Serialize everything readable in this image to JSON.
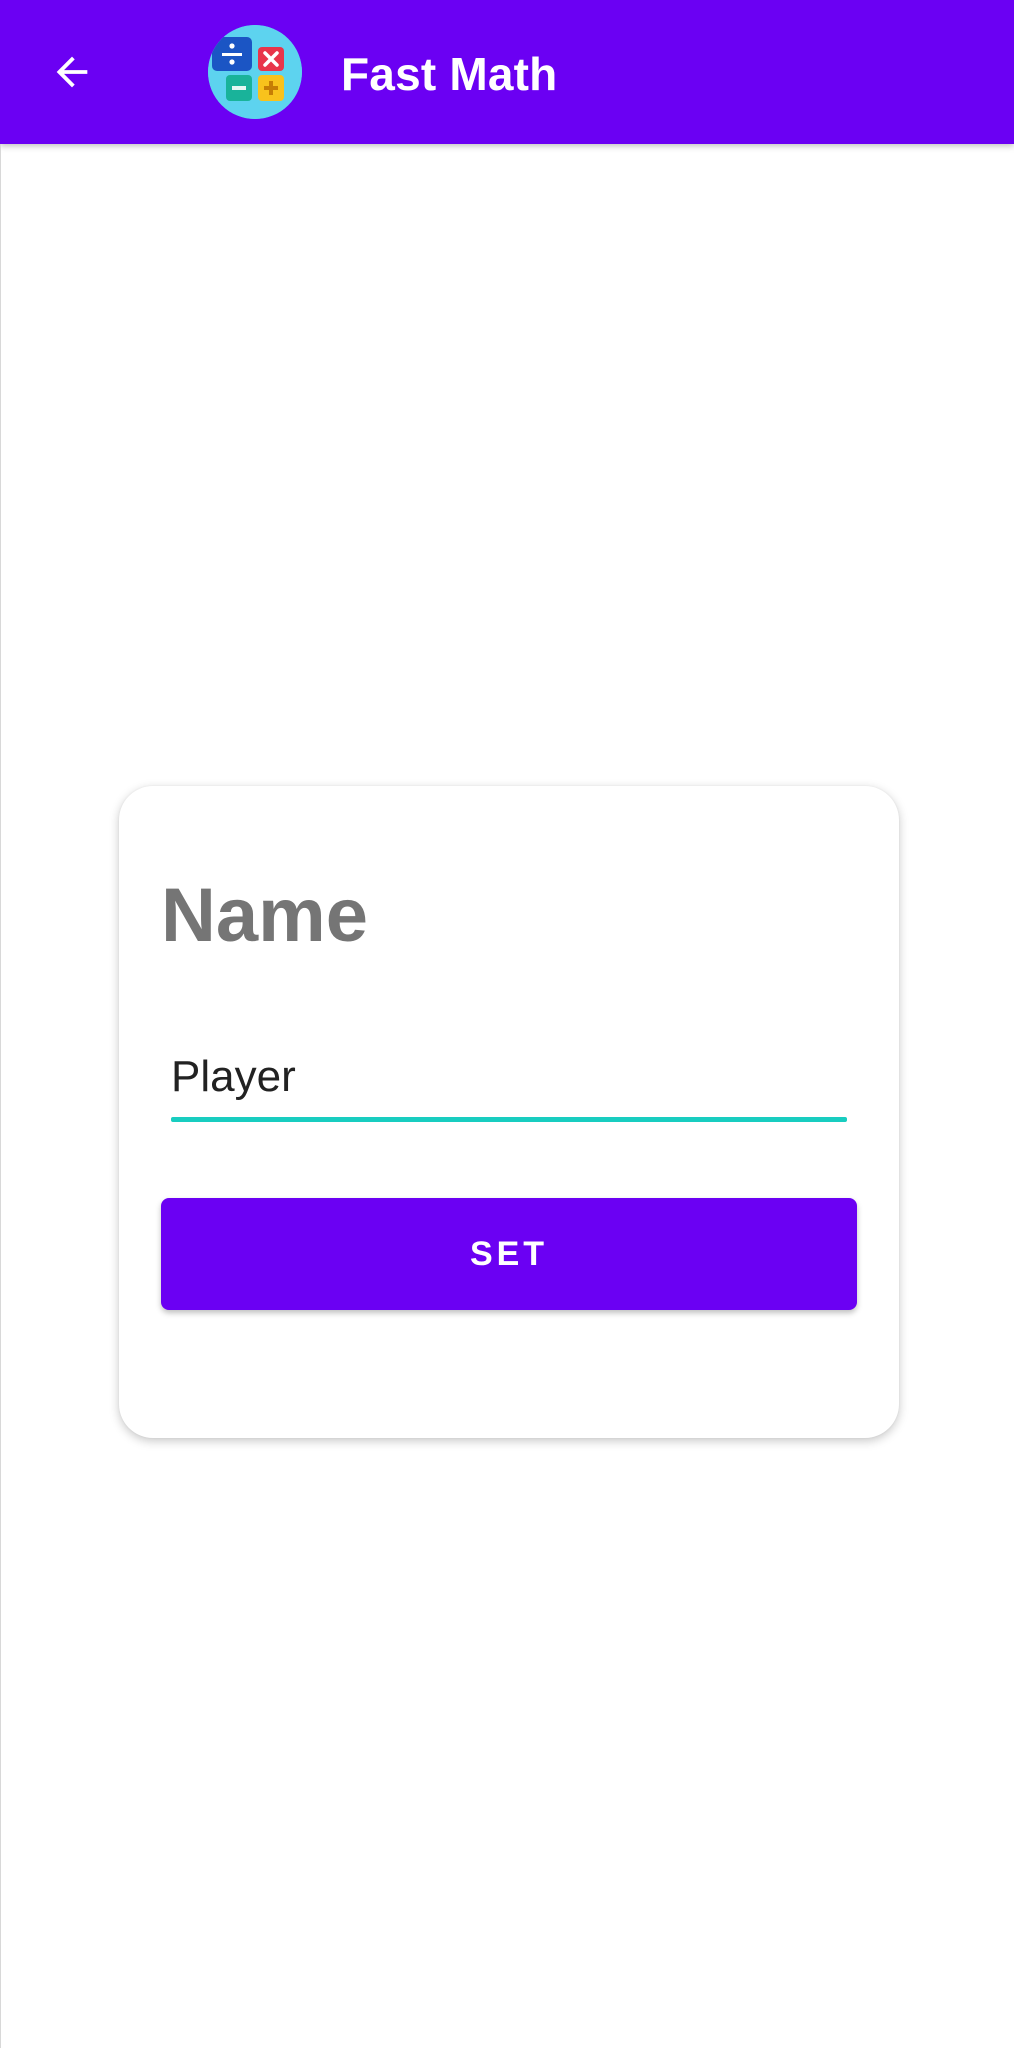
{
  "appbar": {
    "title": "Fast Math",
    "background_color": "#6b00f3",
    "back_icon": "arrow-left-icon",
    "logo_icon": "math-operators-logo-icon"
  },
  "card": {
    "title": "Name",
    "name_field": {
      "value": "Player",
      "underline_color": "#18cdc0"
    },
    "set_button": {
      "label": "SET",
      "color": "#6b00f3"
    }
  }
}
